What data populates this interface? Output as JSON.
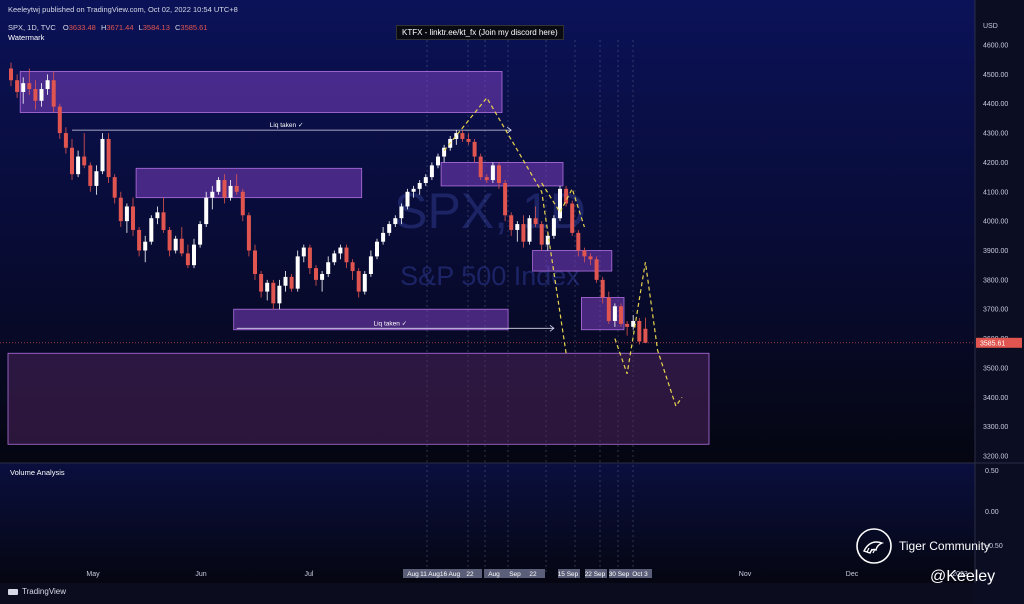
{
  "header": {
    "publisher_line": "Keeleytwj published on TradingView.com, Oct 02, 2022 10:54 UTC+8",
    "symbol_line": "SPX, 1D, TVC",
    "ohlc": {
      "o_label": "O",
      "o": "3633.48",
      "h_label": "H",
      "h": "3671.44",
      "l_label": "L",
      "l": "3584.13",
      "c_label": "C",
      "c": "3585.61"
    },
    "watermark_label": "Watermark"
  },
  "banner": "KTFX - linktr.ee/kt_fx (Join my discord here)",
  "watermark_text": {
    "big": "SPX, 1D",
    "sub": "S&P 500 Index"
  },
  "annotations": {
    "liq_upper": "Liq taken ✓",
    "liq_lower": "Liq taken ✓"
  },
  "volume_panel": {
    "title": "Volume Analysis",
    "ticks": [
      "0.50",
      "0.00",
      "−0.50"
    ]
  },
  "footer": {
    "tradingview": "TradingView",
    "tiger": "Tiger Community",
    "handle": "@Keeley"
  },
  "colors": {
    "up": "#ffffff",
    "down": "#e0554f",
    "zone": "#7a3fbf",
    "projection": "#e8d44d",
    "bg_top": "#0a0f4a",
    "bg_bottom": "#05060f"
  },
  "chart_data": {
    "type": "candlestick",
    "y_axis": {
      "unit": "USD",
      "ticks": [
        4600,
        4500,
        4400,
        4300,
        4200,
        4100,
        4000,
        3900,
        3800,
        3700,
        3600,
        3500,
        3400,
        3300,
        3200
      ],
      "ylim": [
        3180,
        4660
      ]
    },
    "x_axis": {
      "ticks": [
        "May",
        "Jun",
        "Jul",
        "Aug",
        "Sep",
        "Oct",
        "Nov",
        "Dec",
        "2023"
      ],
      "crosshair_labels": [
        "Aug",
        "11 Aug",
        "16 Aug",
        "22",
        "Aug",
        "Sep",
        "22",
        "15 Sep",
        "22 Sep",
        "30 Sep",
        "Oct 3"
      ]
    },
    "current_price": 3585.61,
    "candles": [
      [
        4520,
        4540,
        4460,
        4480
      ],
      [
        4480,
        4500,
        4420,
        4440
      ],
      [
        4440,
        4490,
        4400,
        4470
      ],
      [
        4470,
        4520,
        4430,
        4450
      ],
      [
        4450,
        4480,
        4380,
        4410
      ],
      [
        4410,
        4470,
        4390,
        4450
      ],
      [
        4450,
        4500,
        4430,
        4480
      ],
      [
        4480,
        4510,
        4370,
        4390
      ],
      [
        4390,
        4400,
        4280,
        4300
      ],
      [
        4300,
        4320,
        4230,
        4250
      ],
      [
        4250,
        4280,
        4140,
        4160
      ],
      [
        4160,
        4240,
        4150,
        4220
      ],
      [
        4220,
        4300,
        4180,
        4190
      ],
      [
        4190,
        4200,
        4100,
        4120
      ],
      [
        4120,
        4190,
        4090,
        4170
      ],
      [
        4170,
        4300,
        4160,
        4280
      ],
      [
        4280,
        4300,
        4130,
        4150
      ],
      [
        4150,
        4160,
        4060,
        4080
      ],
      [
        4080,
        4100,
        3980,
        4000
      ],
      [
        4000,
        4060,
        3960,
        4050
      ],
      [
        4050,
        4080,
        3950,
        3970
      ],
      [
        3970,
        3980,
        3880,
        3900
      ],
      [
        3900,
        3950,
        3860,
        3930
      ],
      [
        3930,
        4020,
        3920,
        4010
      ],
      [
        4010,
        4050,
        3990,
        4030
      ],
      [
        4030,
        4080,
        3960,
        3970
      ],
      [
        3970,
        3980,
        3880,
        3900
      ],
      [
        3900,
        3950,
        3890,
        3940
      ],
      [
        3940,
        3980,
        3880,
        3890
      ],
      [
        3890,
        3920,
        3840,
        3850
      ],
      [
        3850,
        3940,
        3840,
        3920
      ],
      [
        3920,
        4000,
        3910,
        3990
      ],
      [
        3990,
        4100,
        3980,
        4080
      ],
      [
        4080,
        4120,
        4040,
        4100
      ],
      [
        4100,
        4150,
        4090,
        4140
      ],
      [
        4140,
        4160,
        4060,
        4080
      ],
      [
        4080,
        4140,
        4070,
        4120
      ],
      [
        4120,
        4160,
        4090,
        4100
      ],
      [
        4100,
        4110,
        4000,
        4020
      ],
      [
        4020,
        4030,
        3880,
        3900
      ],
      [
        3900,
        3920,
        3800,
        3820
      ],
      [
        3820,
        3830,
        3740,
        3760
      ],
      [
        3760,
        3800,
        3730,
        3790
      ],
      [
        3790,
        3800,
        3700,
        3720
      ],
      [
        3720,
        3800,
        3700,
        3780
      ],
      [
        3780,
        3830,
        3760,
        3810
      ],
      [
        3810,
        3820,
        3760,
        3770
      ],
      [
        3770,
        3900,
        3760,
        3880
      ],
      [
        3880,
        3920,
        3860,
        3910
      ],
      [
        3910,
        3920,
        3820,
        3840
      ],
      [
        3840,
        3850,
        3780,
        3800
      ],
      [
        3800,
        3830,
        3760,
        3820
      ],
      [
        3820,
        3880,
        3810,
        3860
      ],
      [
        3860,
        3900,
        3850,
        3890
      ],
      [
        3890,
        3920,
        3870,
        3910
      ],
      [
        3910,
        3920,
        3840,
        3860
      ],
      [
        3860,
        3870,
        3800,
        3830
      ],
      [
        3830,
        3840,
        3740,
        3760
      ],
      [
        3760,
        3830,
        3750,
        3820
      ],
      [
        3820,
        3900,
        3810,
        3880
      ],
      [
        3880,
        3940,
        3870,
        3930
      ],
      [
        3930,
        3980,
        3920,
        3960
      ],
      [
        3960,
        4000,
        3950,
        3990
      ],
      [
        3990,
        4020,
        3980,
        4010
      ],
      [
        4010,
        4060,
        3990,
        4050
      ],
      [
        4050,
        4110,
        4040,
        4100
      ],
      [
        4100,
        4120,
        4080,
        4110
      ],
      [
        4110,
        4140,
        4090,
        4130
      ],
      [
        4130,
        4160,
        4120,
        4150
      ],
      [
        4150,
        4200,
        4140,
        4190
      ],
      [
        4190,
        4230,
        4180,
        4220
      ],
      [
        4220,
        4260,
        4200,
        4250
      ],
      [
        4250,
        4290,
        4240,
        4280
      ],
      [
        4280,
        4310,
        4260,
        4300
      ],
      [
        4300,
        4310,
        4270,
        4280
      ],
      [
        4280,
        4300,
        4260,
        4270
      ],
      [
        4270,
        4280,
        4200,
        4220
      ],
      [
        4220,
        4230,
        4140,
        4150
      ],
      [
        4150,
        4160,
        4130,
        4140
      ],
      [
        4140,
        4200,
        4130,
        4190
      ],
      [
        4190,
        4200,
        4110,
        4130
      ],
      [
        4130,
        4140,
        4000,
        4020
      ],
      [
        4020,
        4030,
        3950,
        3970
      ],
      [
        3970,
        4000,
        3930,
        3990
      ],
      [
        3990,
        4020,
        3910,
        3930
      ],
      [
        3930,
        4020,
        3920,
        4010
      ],
      [
        4010,
        4050,
        3980,
        3990
      ],
      [
        3990,
        4000,
        3900,
        3920
      ],
      [
        3920,
        3960,
        3900,
        3950
      ],
      [
        3950,
        4020,
        3940,
        4010
      ],
      [
        4010,
        4120,
        4000,
        4110
      ],
      [
        4110,
        4120,
        4050,
        4060
      ],
      [
        4060,
        4070,
        3950,
        3960
      ],
      [
        3960,
        3970,
        3880,
        3900
      ],
      [
        3900,
        3910,
        3860,
        3880
      ],
      [
        3880,
        3890,
        3850,
        3870
      ],
      [
        3870,
        3880,
        3790,
        3800
      ],
      [
        3800,
        3810,
        3720,
        3740
      ],
      [
        3740,
        3760,
        3650,
        3660
      ],
      [
        3660,
        3720,
        3640,
        3710
      ],
      [
        3710,
        3720,
        3640,
        3650
      ],
      [
        3650,
        3660,
        3610,
        3640
      ],
      [
        3640,
        3680,
        3630,
        3660
      ],
      [
        3660,
        3670,
        3580,
        3590
      ],
      [
        3633.48,
        3671.44,
        3584.13,
        3585.61
      ]
    ],
    "zones": [
      {
        "from_index": 2,
        "to_index": 80,
        "top": 4510,
        "bottom": 4370
      },
      {
        "from_index": 21,
        "to_index": 57,
        "top": 4180,
        "bottom": 4080
      },
      {
        "from_index": 71,
        "to_index": 90,
        "top": 4200,
        "bottom": 4120
      },
      {
        "from_index": 86,
        "to_index": 98,
        "top": 3900,
        "bottom": 3830
      },
      {
        "from_index": 94,
        "to_index": 100,
        "top": 3740,
        "bottom": 3630
      },
      {
        "from_index": 37,
        "to_index": 81,
        "top": 3700,
        "bottom": 3630
      },
      {
        "from_index": 0,
        "to_index": 100,
        "top": 3550,
        "bottom": 3240
      }
    ],
    "liquidity_lines": [
      {
        "from_index": 10,
        "to_index": 82,
        "price": 4310,
        "label_key": "liq_upper"
      },
      {
        "from_index": 37,
        "to_index": 89,
        "price": 3635,
        "label_key": "liq_lower"
      }
    ],
    "projections": [
      [
        [
          71,
          4240
        ],
        [
          78,
          4420
        ],
        [
          87,
          4100
        ],
        [
          91,
          3550
        ]
      ],
      [
        [
          87,
          4130
        ],
        [
          90,
          4030
        ],
        [
          92,
          4110
        ],
        [
          94,
          3980
        ]
      ],
      [
        [
          99,
          3600
        ],
        [
          101,
          3480
        ],
        [
          104,
          3860
        ],
        [
          106,
          3560
        ],
        [
          109,
          3370
        ],
        [
          110,
          3400
        ]
      ]
    ]
  }
}
